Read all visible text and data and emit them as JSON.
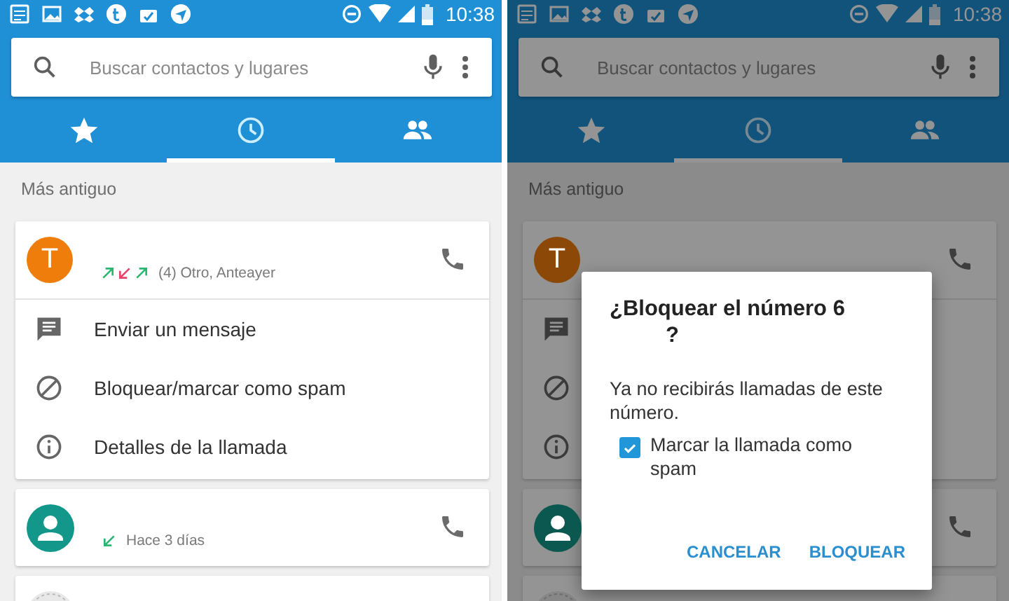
{
  "screens": [
    {
      "status_bar": {
        "time": "10:38"
      },
      "search": {
        "placeholder": "Buscar contactos y lugares"
      },
      "tabs": [
        {
          "kind": "star",
          "selected": false
        },
        {
          "kind": "clock",
          "selected": true
        },
        {
          "kind": "people",
          "selected": false
        }
      ],
      "section": "Más antiguo",
      "calls": [
        {
          "avatar": {
            "kind": "letter",
            "letter": "T",
            "color": "#ef7d0b"
          },
          "arrows": [
            {
              "kind": "outgoing"
            },
            {
              "kind": "missed"
            },
            {
              "kind": "outgoing"
            }
          ],
          "subtitle": "(4) Otro, Anteayer",
          "expanded": true,
          "actions": [
            {
              "kind": "message",
              "label": "Enviar un mensaje"
            },
            {
              "kind": "block",
              "label": "Bloquear/marcar como spam"
            },
            {
              "kind": "info",
              "label": "Detalles de la llamada"
            }
          ]
        },
        {
          "avatar": {
            "kind": "person",
            "color": "#13978a"
          },
          "arrows": [
            {
              "kind": "incoming"
            }
          ],
          "subtitle": "Hace 3 días"
        },
        {
          "avatar": {
            "kind": "picture"
          }
        }
      ]
    },
    {
      "status_bar": {
        "time": "10:38"
      },
      "search": {
        "placeholder": "Buscar contactos y lugares"
      },
      "tabs": [
        {
          "kind": "star",
          "selected": false
        },
        {
          "kind": "clock",
          "selected": true
        },
        {
          "kind": "people",
          "selected": false
        }
      ],
      "section": "Más antiguo",
      "calls": [
        {
          "avatar": {
            "kind": "letter",
            "letter": "T",
            "color": "#8b4806"
          },
          "expanded": true,
          "actions": [
            {
              "kind": "message"
            },
            {
              "kind": "block"
            },
            {
              "kind": "info"
            }
          ]
        },
        {
          "avatar": {
            "kind": "person",
            "color": "#0b5850"
          }
        },
        {
          "avatar": {
            "kind": "picture"
          }
        }
      ],
      "dialog": {
        "title_lines": [
          "¿Bloquear el número 6",
          "?"
        ],
        "message": "Ya no recibirás llamadas de este número.",
        "checkbox": {
          "label": "Marcar la llamada como spam",
          "checked": true
        },
        "buttons": [
          "CANCELAR",
          "BLOQUEAR"
        ]
      }
    }
  ]
}
